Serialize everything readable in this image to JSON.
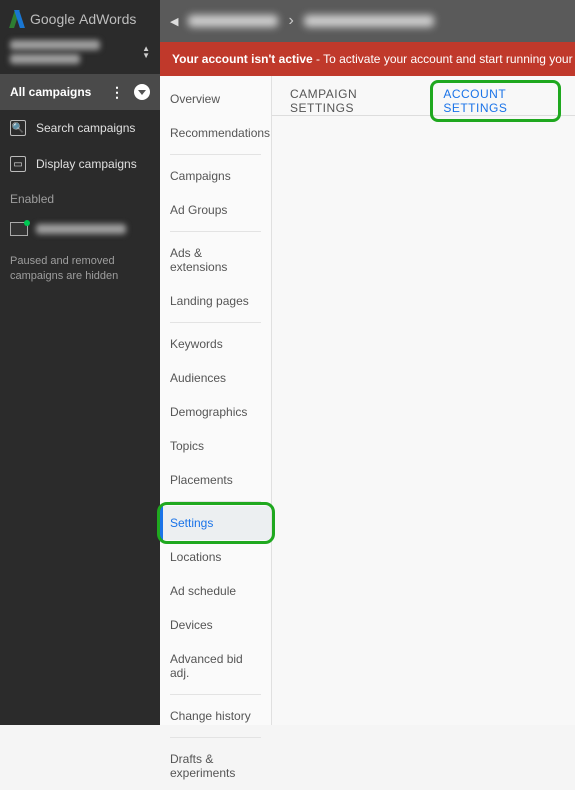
{
  "brand": {
    "name": "Google",
    "product": "AdWords"
  },
  "sidebar": {
    "all_campaigns_label": "All campaigns",
    "items": [
      {
        "label": "Search campaigns"
      },
      {
        "label": "Display campaigns"
      }
    ],
    "enabled_label": "Enabled",
    "hidden_note": "Paused and removed campaigns are hidden"
  },
  "topbar": {
    "separator": "›"
  },
  "alert": {
    "bold": "Your account isn't active",
    "rest": " - To activate your account and start running your ads, enter your bil"
  },
  "secnav": [
    {
      "label": "Overview"
    },
    {
      "label": "Recommendations"
    },
    {
      "divider": true
    },
    {
      "label": "Campaigns"
    },
    {
      "label": "Ad Groups"
    },
    {
      "divider": true
    },
    {
      "label": "Ads & extensions"
    },
    {
      "label": "Landing pages"
    },
    {
      "divider": true
    },
    {
      "label": "Keywords"
    },
    {
      "label": "Audiences"
    },
    {
      "label": "Demographics"
    },
    {
      "label": "Topics"
    },
    {
      "label": "Placements"
    },
    {
      "divider": true
    },
    {
      "label": "Settings",
      "active": true,
      "highlight": true
    },
    {
      "label": "Locations"
    },
    {
      "label": "Ad schedule"
    },
    {
      "label": "Devices"
    },
    {
      "label": "Advanced bid adj."
    },
    {
      "divider": true
    },
    {
      "label": "Change history"
    },
    {
      "divider": true
    },
    {
      "label": "Drafts & experiments"
    }
  ],
  "tabs": {
    "campaign": "CAMPAIGN SETTINGS",
    "account": "ACCOUNT SETTINGS"
  }
}
